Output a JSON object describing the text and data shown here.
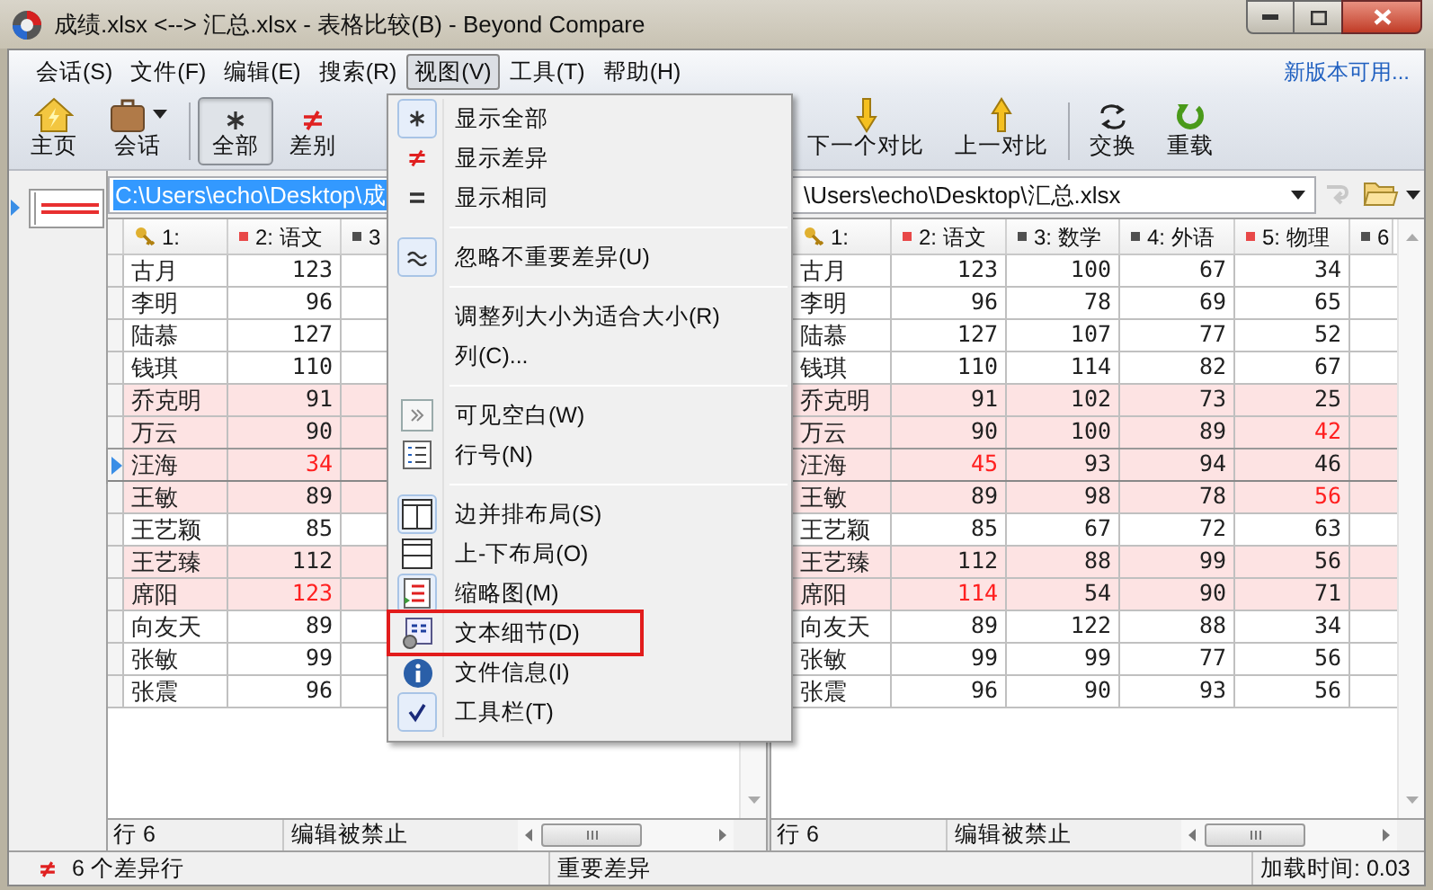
{
  "window": {
    "title": "成绩.xlsx <--> 汇总.xlsx - 表格比较(B) - Beyond Compare"
  },
  "menu_bar": [
    {
      "label": "会话(S)",
      "selected": false
    },
    {
      "label": "文件(F)",
      "selected": false
    },
    {
      "label": "编辑(E)",
      "selected": false
    },
    {
      "label": "搜索(R)",
      "selected": false
    },
    {
      "label": "视图(V)",
      "selected": true
    },
    {
      "label": "工具(T)",
      "selected": false
    },
    {
      "label": "帮助(H)",
      "selected": false
    }
  ],
  "update_link": "新版本可用...",
  "toolbar_left": [
    {
      "label": "主页",
      "selected": false,
      "dropdown": false
    },
    {
      "label": "会话",
      "selected": false,
      "dropdown": true
    },
    {
      "label": "全部",
      "selected": true,
      "dropdown": false
    },
    {
      "label": "差别",
      "selected": false,
      "dropdown": false
    }
  ],
  "toolbar_right": [
    {
      "label": "下一个对比",
      "selected": false,
      "dropdown": false
    },
    {
      "label": "上一对比",
      "selected": false,
      "dropdown": false
    },
    {
      "label": "交换",
      "selected": false,
      "dropdown": false
    },
    {
      "label": "重载",
      "selected": false,
      "dropdown": false
    }
  ],
  "view_menu": [
    {
      "kind": "item",
      "label": "显示全部",
      "checked": true,
      "annotated": false
    },
    {
      "kind": "item",
      "label": "显示差异",
      "checked": false,
      "annotated": false
    },
    {
      "kind": "item",
      "label": "显示相同",
      "checked": false,
      "annotated": false
    },
    {
      "kind": "separator"
    },
    {
      "kind": "item",
      "label": "忽略不重要差异(U)",
      "checked": true,
      "annotated": false
    },
    {
      "kind": "separator"
    },
    {
      "kind": "item",
      "label": "调整列大小为适合大小(R)",
      "checked": false,
      "annotated": false
    },
    {
      "kind": "item",
      "label": "列(C)...",
      "checked": false,
      "annotated": false
    },
    {
      "kind": "separator"
    },
    {
      "kind": "item",
      "label": "可见空白(W)",
      "checked": false,
      "annotated": false
    },
    {
      "kind": "item",
      "label": "行号(N)",
      "checked": false,
      "annotated": false
    },
    {
      "kind": "separator"
    },
    {
      "kind": "item",
      "label": "边并排布局(S)",
      "checked": true,
      "annotated": false
    },
    {
      "kind": "item",
      "label": "上-下布局(O)",
      "checked": false,
      "annotated": false
    },
    {
      "kind": "item",
      "label": "缩略图(M)",
      "checked": true,
      "annotated": false
    },
    {
      "kind": "item",
      "label": "文本细节(D)",
      "checked": false,
      "annotated": true
    },
    {
      "kind": "item",
      "label": "文件信息(I)",
      "checked": false,
      "annotated": false
    },
    {
      "kind": "item",
      "label": "工具栏(T)",
      "checked": true,
      "annotated": false
    }
  ],
  "left_pane": {
    "path": "C:\\Users\\echo\\Desktop\\成",
    "path_selected": true,
    "columns": [
      {
        "kind": "key",
        "label": "1:"
      },
      {
        "kind": "marker",
        "label": "2: 语文",
        "color": "#e84848"
      },
      {
        "kind": "marker",
        "label": "3",
        "color": "#505050"
      }
    ],
    "rows": [
      {
        "name": "古月",
        "values": [
          {
            "text": "123",
            "changed": false
          }
        ],
        "different": false,
        "current": false
      },
      {
        "name": "李明",
        "values": [
          {
            "text": "96",
            "changed": false
          }
        ],
        "different": false,
        "current": false
      },
      {
        "name": "陆慕",
        "values": [
          {
            "text": "127",
            "changed": false
          }
        ],
        "different": false,
        "current": false
      },
      {
        "name": "钱琪",
        "values": [
          {
            "text": "110",
            "changed": false
          }
        ],
        "different": false,
        "current": false
      },
      {
        "name": "乔克明",
        "values": [
          {
            "text": "91",
            "changed": false
          }
        ],
        "different": true,
        "current": false
      },
      {
        "name": "万云",
        "values": [
          {
            "text": "90",
            "changed": false
          }
        ],
        "different": true,
        "current": false
      },
      {
        "name": "汪海",
        "values": [
          {
            "text": "34",
            "changed": true
          }
        ],
        "different": true,
        "current": true
      },
      {
        "name": "王敏",
        "values": [
          {
            "text": "89",
            "changed": false
          }
        ],
        "different": true,
        "current": false
      },
      {
        "name": "王艺颖",
        "values": [
          {
            "text": "85",
            "changed": false
          }
        ],
        "different": false,
        "current": false
      },
      {
        "name": "王艺臻",
        "values": [
          {
            "text": "112",
            "changed": false
          }
        ],
        "different": true,
        "current": false
      },
      {
        "name": "席阳",
        "values": [
          {
            "text": "123",
            "changed": true
          }
        ],
        "different": true,
        "current": false
      },
      {
        "name": "向友天",
        "values": [
          {
            "text": "89",
            "changed": false
          }
        ],
        "different": false,
        "current": false
      },
      {
        "name": "张敏",
        "values": [
          {
            "text": "99",
            "changed": false
          }
        ],
        "different": false,
        "current": false
      },
      {
        "name": "张震",
        "values": [
          {
            "text": "96",
            "changed": false
          }
        ],
        "different": false,
        "current": false
      }
    ],
    "status": {
      "row": "行 6",
      "editing": "编辑被禁止"
    }
  },
  "right_pane": {
    "path": "\\Users\\echo\\Desktop\\汇总.xlsx",
    "path_selected": false,
    "columns": [
      {
        "kind": "key",
        "label": "1:"
      },
      {
        "kind": "marker",
        "label": "2: 语文",
        "color": "#e84848"
      },
      {
        "kind": "marker",
        "label": "3: 数学",
        "color": "#505050"
      },
      {
        "kind": "marker",
        "label": "4: 外语",
        "color": "#505050"
      },
      {
        "kind": "marker",
        "label": "5: 物理",
        "color": "#e84848"
      },
      {
        "kind": "marker",
        "label": "6",
        "color": "#505050"
      }
    ],
    "rows": [
      {
        "name": "古月",
        "values": [
          {
            "text": "123",
            "changed": false
          },
          {
            "text": "100",
            "changed": false
          },
          {
            "text": "67",
            "changed": false
          },
          {
            "text": "34",
            "changed": false
          }
        ],
        "different": false,
        "current": false
      },
      {
        "name": "李明",
        "values": [
          {
            "text": "96",
            "changed": false
          },
          {
            "text": "78",
            "changed": false
          },
          {
            "text": "69",
            "changed": false
          },
          {
            "text": "65",
            "changed": false
          }
        ],
        "different": false,
        "current": false
      },
      {
        "name": "陆慕",
        "values": [
          {
            "text": "127",
            "changed": false
          },
          {
            "text": "107",
            "changed": false
          },
          {
            "text": "77",
            "changed": false
          },
          {
            "text": "52",
            "changed": false
          }
        ],
        "different": false,
        "current": false
      },
      {
        "name": "钱琪",
        "values": [
          {
            "text": "110",
            "changed": false
          },
          {
            "text": "114",
            "changed": false
          },
          {
            "text": "82",
            "changed": false
          },
          {
            "text": "67",
            "changed": false
          }
        ],
        "different": false,
        "current": false
      },
      {
        "name": "乔克明",
        "values": [
          {
            "text": "91",
            "changed": false
          },
          {
            "text": "102",
            "changed": false
          },
          {
            "text": "73",
            "changed": false
          },
          {
            "text": "25",
            "changed": false
          }
        ],
        "different": true,
        "current": false
      },
      {
        "name": "万云",
        "values": [
          {
            "text": "90",
            "changed": false
          },
          {
            "text": "100",
            "changed": false
          },
          {
            "text": "89",
            "changed": false
          },
          {
            "text": "42",
            "changed": true
          }
        ],
        "different": true,
        "current": false
      },
      {
        "name": "汪海",
        "values": [
          {
            "text": "45",
            "changed": true
          },
          {
            "text": "93",
            "changed": false
          },
          {
            "text": "94",
            "changed": false
          },
          {
            "text": "46",
            "changed": false
          }
        ],
        "different": true,
        "current": true
      },
      {
        "name": "王敏",
        "values": [
          {
            "text": "89",
            "changed": false
          },
          {
            "text": "98",
            "changed": false
          },
          {
            "text": "78",
            "changed": false
          },
          {
            "text": "56",
            "changed": true
          }
        ],
        "different": true,
        "current": false
      },
      {
        "name": "王艺颖",
        "values": [
          {
            "text": "85",
            "changed": false
          },
          {
            "text": "67",
            "changed": false
          },
          {
            "text": "72",
            "changed": false
          },
          {
            "text": "63",
            "changed": false
          }
        ],
        "different": false,
        "current": false
      },
      {
        "name": "王艺臻",
        "values": [
          {
            "text": "112",
            "changed": false
          },
          {
            "text": "88",
            "changed": false
          },
          {
            "text": "99",
            "changed": false
          },
          {
            "text": "56",
            "changed": false
          }
        ],
        "different": true,
        "current": false
      },
      {
        "name": "席阳",
        "values": [
          {
            "text": "114",
            "changed": true
          },
          {
            "text": "54",
            "changed": false
          },
          {
            "text": "90",
            "changed": false
          },
          {
            "text": "71",
            "changed": false
          }
        ],
        "different": true,
        "current": false
      },
      {
        "name": "向友天",
        "values": [
          {
            "text": "89",
            "changed": false
          },
          {
            "text": "122",
            "changed": false
          },
          {
            "text": "88",
            "changed": false
          },
          {
            "text": "34",
            "changed": false
          }
        ],
        "different": false,
        "current": false
      },
      {
        "name": "张敏",
        "values": [
          {
            "text": "99",
            "changed": false
          },
          {
            "text": "99",
            "changed": false
          },
          {
            "text": "77",
            "changed": false
          },
          {
            "text": "56",
            "changed": false
          }
        ],
        "different": false,
        "current": false
      },
      {
        "name": "张震",
        "values": [
          {
            "text": "96",
            "changed": false
          },
          {
            "text": "90",
            "changed": false
          },
          {
            "text": "93",
            "changed": false
          },
          {
            "text": "56",
            "changed": false
          }
        ],
        "different": false,
        "current": false
      }
    ],
    "status": {
      "row": "行 6",
      "editing": "编辑被禁止"
    }
  },
  "status_bar": {
    "diff_count": "6 个差异行",
    "filter": "重要差异",
    "load_time": "加载时间: 0.03"
  }
}
